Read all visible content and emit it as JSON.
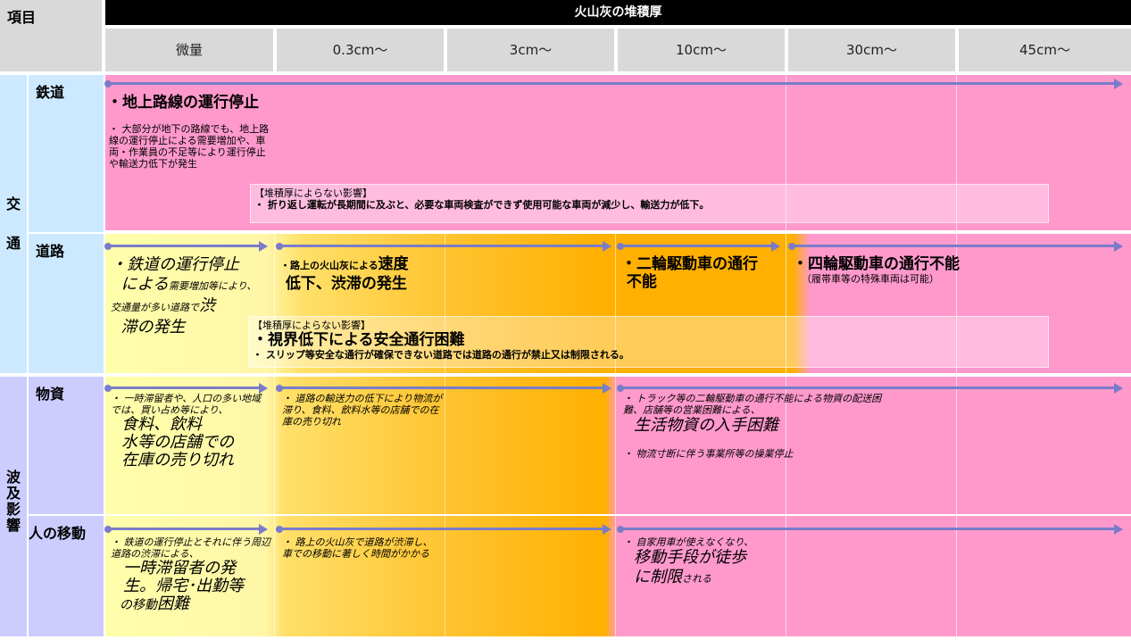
{
  "header": {
    "item_label": "項目",
    "title": "火山灰の堆積厚",
    "columns": [
      "微量",
      "0.3cm〜",
      "3cm〜",
      "10cm〜",
      "30cm〜",
      "45cm〜"
    ]
  },
  "categories": {
    "traffic": "交\n\n通",
    "ripple": "波\n及\n影\n響"
  },
  "rail": {
    "label": "鉄道",
    "heading": "・地上路線の運行停止",
    "detail": "・ 大部分が地下の路線でも、地上路線の運行停止による需要増加や、車両・作業員の不足等により運行停止や輸送力低下が発生",
    "note_title": "【堆積厚によらない影響】",
    "note_body": "・ 折り返し運転が長期間に及ぶと、必要な車両検査ができず使用可能な車両が減少し、輸送力が低下。"
  },
  "road": {
    "label": "道路",
    "c1_a": "・鉄道の運行停止",
    "c1_b": "による",
    "c1_c": "需要増加等により、",
    "c1_d": "交通量が多い道路で",
    "c1_e": "渋",
    "c1_f": "滞の発生",
    "c2_small": "・路上の火山灰による",
    "c2_big1": "速度",
    "c2_big2": "低下、渋滞の発生",
    "c3_a": "・二輪駆動車の通行",
    "c3_b": "不能",
    "c4_title": "・四輪駆動車の通行不能",
    "c4_sub": "（履帯車等の特殊車両は可能）",
    "note_title": "【堆積厚によらない影響】",
    "note_head": "・視界低下による安全通行困難",
    "note_body": "・ スリップ等安全な通行が確保できない道路では道路の通行が禁止又は制限される。"
  },
  "goods": {
    "label": "物資",
    "c1_small": "・ 一時滞留者や、人口の多い地域では、買い占め等により、",
    "c1_big1": "食料、飲料",
    "c1_big2": "水等の店舗での",
    "c1_big3": "在庫の売り切れ",
    "c2": "・ 道路の輸送力の低下により物流が滞り、食料、飲料水等の店舗での在庫の売り切れ",
    "c3_small": "・ トラック等の二輪駆動車の通行不能による物資の配送困難、店舗等の営業困難による、",
    "c3_big": "生活物資の入手困難",
    "c3_extra": "・ 物流寸断に伴う事業所等の操業停止"
  },
  "people": {
    "label": "人の移動",
    "c1_small": "・ 鉄道の運行停止とそれに伴う周辺道路の渋滞による、",
    "c1_big1": "一時滞留者の発",
    "c1_big2": "生。帰宅･出勤等",
    "c1_c": "の移動",
    "c1_d": "困難",
    "c2": "・ 路上の火山灰で道路が渋滞し、車での移動に著しく時間がかかる",
    "c3_small": "・ 自家用車が使えなくなり、",
    "c3_big1": "移動手段が徒歩",
    "c3_big2": "に制限",
    "c3_suffix": "される"
  },
  "colors": {
    "pink": "#ff99cc",
    "yellow": "#ffff99",
    "orange": "#ffb000",
    "traffic_bg": "#cce9ff",
    "ripple_bg": "#ccccff",
    "arrow": "#7a7cc9"
  }
}
